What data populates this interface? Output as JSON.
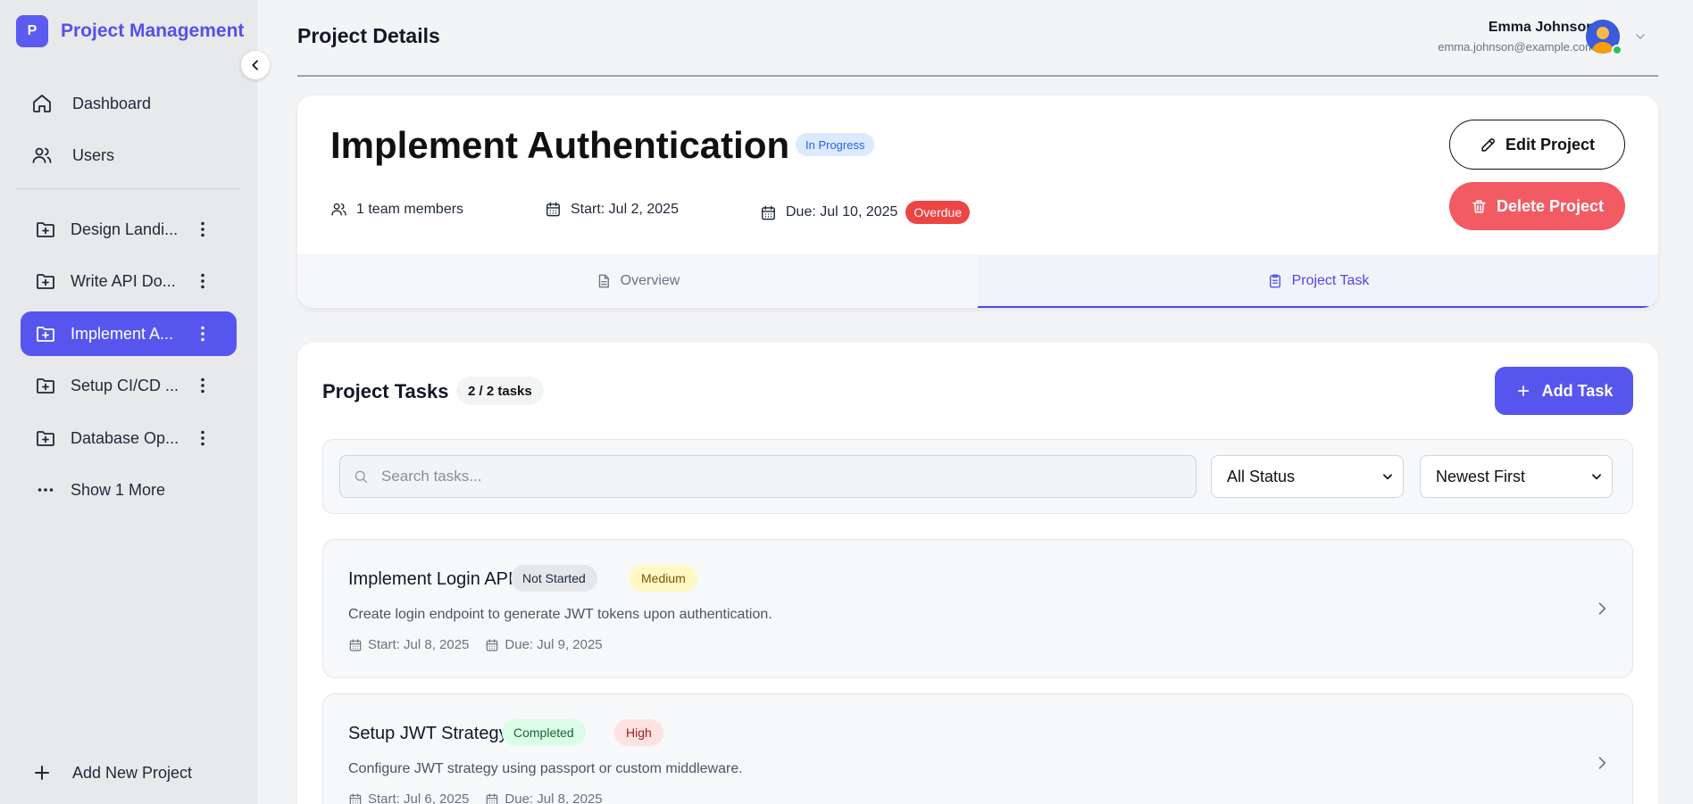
{
  "brand": {
    "logo_letter": "P",
    "name": "Project Management",
    "accent": "#5656ef"
  },
  "sidebar": {
    "nav": [
      {
        "label": "Dashboard",
        "icon": "home-icon"
      },
      {
        "label": "Users",
        "icon": "users-icon"
      }
    ],
    "projects": [
      {
        "label": "Design Landi...",
        "active": false
      },
      {
        "label": "Write API Do...",
        "active": false
      },
      {
        "label": "Implement A...",
        "active": true
      },
      {
        "label": "Setup CI/CD ...",
        "active": false
      },
      {
        "label": "Database Op...",
        "active": false
      }
    ],
    "show_more": "Show 1 More",
    "add_project": "Add New Project"
  },
  "header": {
    "title": "Project Details",
    "user": {
      "name": "Emma Johnson",
      "email": "emma.johnson@example.com",
      "online": true
    }
  },
  "project": {
    "name": "Implement Authentication",
    "status": "In Progress",
    "team": "1 team members",
    "start": "Start: Jul 2, 2025",
    "due": "Due: Jul 10, 2025",
    "overdue": "Overdue",
    "edit_label": "Edit Project",
    "delete_label": "Delete Project",
    "tabs": [
      {
        "label": "Overview",
        "active": false,
        "icon": "document-icon"
      },
      {
        "label": "Project Task",
        "active": true,
        "icon": "clipboard-icon"
      }
    ]
  },
  "tasks": {
    "title": "Project Tasks",
    "count": "2 / 2 tasks",
    "add_label": "Add Task",
    "search_placeholder": "Search tasks...",
    "status_filter": "All Status",
    "sort": "Newest First",
    "items": [
      {
        "name": "Implement Login API",
        "status": "Not Started",
        "priority": "Medium",
        "description": "Create login endpoint to generate JWT tokens upon authentication.",
        "start": "Start: Jul 8, 2025",
        "due": "Due: Jul 9, 2025"
      },
      {
        "name": "Setup JWT Strategy",
        "status": "Completed",
        "priority": "High",
        "description": "Configure JWT strategy using passport or custom middleware.",
        "start": "Start: Jul 6, 2025",
        "due": "Due: Jul 8, 2025"
      }
    ]
  }
}
